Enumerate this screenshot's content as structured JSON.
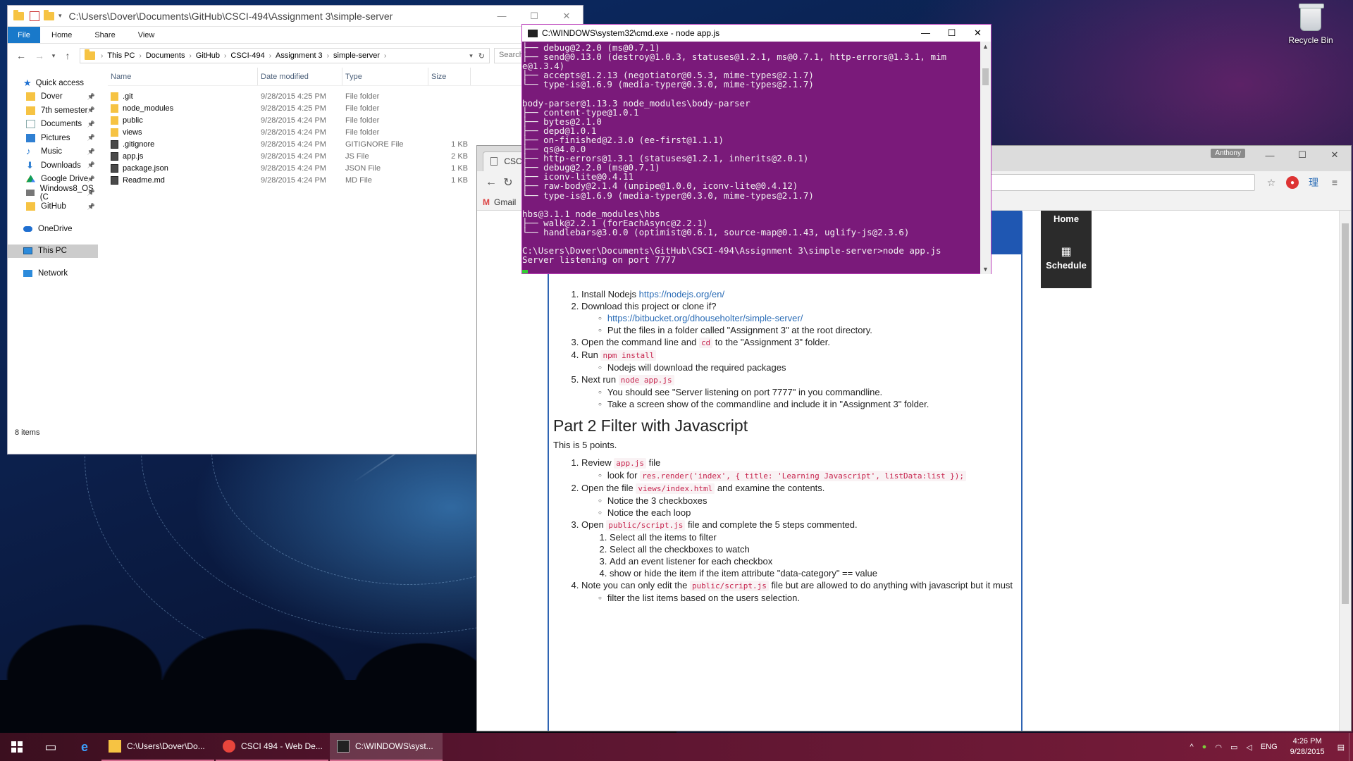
{
  "desktop": {
    "recycle_bin_label": "Recycle Bin"
  },
  "explorer": {
    "title": "C:\\Users\\Dover\\Documents\\GitHub\\CSCI-494\\Assignment 3\\simple-server",
    "ribbon_tabs": [
      "File",
      "Home",
      "Share",
      "View"
    ],
    "breadcrumbs": [
      "This PC",
      "Documents",
      "GitHub",
      "CSCI-494",
      "Assignment 3",
      "simple-server"
    ],
    "search_placeholder": "Search simple-s...",
    "nav": [
      {
        "label": "Quick access",
        "icon": "star-icon",
        "head": true
      },
      {
        "label": "Dover",
        "icon": "folder-icon",
        "pinned": false
      },
      {
        "label": "7th semester",
        "icon": "folder-icon",
        "pinned": true
      },
      {
        "label": "Documents",
        "icon": "documents-icon",
        "pinned": true
      },
      {
        "label": "Pictures",
        "icon": "pictures-icon",
        "pinned": true
      },
      {
        "label": "Music",
        "icon": "music-icon",
        "pinned": true
      },
      {
        "label": "Downloads",
        "icon": "download-icon",
        "pinned": true
      },
      {
        "label": "Google Drive",
        "icon": "google-drive-icon",
        "pinned": true
      },
      {
        "label": "Windows8_OS (C",
        "icon": "drive-icon",
        "pinned": true
      },
      {
        "label": "GitHub",
        "icon": "folder-icon",
        "pinned": true
      },
      {
        "label": "OneDrive",
        "icon": "onedrive-icon",
        "head": true
      },
      {
        "label": "This PC",
        "icon": "this-pc-icon",
        "head": true,
        "selected": true
      },
      {
        "label": "Network",
        "icon": "network-icon",
        "head": true
      }
    ],
    "columns": {
      "name": "Name",
      "date": "Date modified",
      "type": "Type",
      "size": "Size"
    },
    "files": [
      {
        "name": ".git",
        "date": "9/28/2015 4:25 PM",
        "type": "File folder",
        "size": "",
        "kind": "folder"
      },
      {
        "name": "node_modules",
        "date": "9/28/2015 4:25 PM",
        "type": "File folder",
        "size": "",
        "kind": "folder"
      },
      {
        "name": "public",
        "date": "9/28/2015 4:24 PM",
        "type": "File folder",
        "size": "",
        "kind": "folder"
      },
      {
        "name": "views",
        "date": "9/28/2015 4:24 PM",
        "type": "File folder",
        "size": "",
        "kind": "folder"
      },
      {
        "name": ".gitignore",
        "date": "9/28/2015 4:24 PM",
        "type": "GITIGNORE File",
        "size": "1 KB",
        "kind": "file"
      },
      {
        "name": "app.js",
        "date": "9/28/2015 4:24 PM",
        "type": "JS File",
        "size": "2 KB",
        "kind": "file"
      },
      {
        "name": "package.json",
        "date": "9/28/2015 4:24 PM",
        "type": "JSON File",
        "size": "1 KB",
        "kind": "file"
      },
      {
        "name": "Readme.md",
        "date": "9/28/2015 4:24 PM",
        "type": "MD File",
        "size": "1 KB",
        "kind": "file"
      }
    ],
    "status": "8 items"
  },
  "cmd": {
    "title": "C:\\WINDOWS\\system32\\cmd.exe - node  app.js",
    "lines": [
      "├── debug@2.2.0 (ms@0.7.1)",
      "├── send@0.13.0 (destroy@1.0.3, statuses@1.2.1, ms@0.7.1, http-errors@1.3.1, mim",
      "e@1.3.4)",
      "├── accepts@1.2.13 (negotiator@0.5.3, mime-types@2.1.7)",
      "└── type-is@1.6.9 (media-typer@0.3.0, mime-types@2.1.7)",
      "",
      "body-parser@1.13.3 node_modules\\body-parser",
      "├── content-type@1.0.1",
      "├── bytes@2.1.0",
      "├── depd@1.0.1",
      "├── on-finished@2.3.0 (ee-first@1.1.1)",
      "├── qs@4.0.0",
      "├── http-errors@1.3.1 (statuses@1.2.1, inherits@2.0.1)",
      "├── debug@2.2.0 (ms@0.7.1)",
      "├── iconv-lite@0.4.11",
      "├── raw-body@2.1.4 (unpipe@1.0.0, iconv-lite@0.4.12)",
      "└── type-is@1.6.9 (media-typer@0.3.0, mime-types@2.1.7)",
      "",
      "hbs@3.1.1 node_modules\\hbs",
      "├── walk@2.2.1 (forEachAsync@2.2.1)",
      "└── handlebars@3.0.0 (optimist@0.6.1, source-map@0.1.43, uglify-js@2.3.6)",
      "",
      "C:\\Users\\Dover\\Documents\\GitHub\\CSCI-494\\Assignment 3\\simple-server>node app.js",
      "Server listening on port 7777"
    ]
  },
  "chrome": {
    "tab_title": "CSCI 494",
    "user_badge": "Anthony",
    "bookmark": "Gmail",
    "side_nav": {
      "home": "Home",
      "schedule": "Schedule"
    },
    "doc": {
      "steps": [
        {
          "text": "Install Nodejs ",
          "link": "https://nodejs.org/en/"
        },
        {
          "text": "Download this project or clone if?"
        },
        {
          "text_a": "Open the command line and ",
          "code": "cd",
          "text_b": " to the \"Assignment 3\" folder."
        },
        {
          "text_a": "Run ",
          "code": "npm install"
        },
        {
          "text_a": "Next run ",
          "code": "node app.js"
        }
      ],
      "step2_sub": [
        "https://bitbucket.org/dhouseholter/simple-server/",
        "Put the files in a folder called \"Assignment 3\" at the root directory."
      ],
      "step4_sub": "Nodejs will download the required packages",
      "step5_sub": [
        "You should see \"Server listening on port 7777\" in you commandline.",
        "Take a screen show of the commandline and include it in \"Assignment 3\" folder."
      ],
      "part2_title": "Part 2 Filter with Javascript",
      "part2_points": "This is 5 points.",
      "p2_s1_a": "Review ",
      "p2_s1_code": "app.js",
      "p2_s1_b": " file",
      "p2_s1_sub_a": "look for ",
      "p2_s1_sub_code": "res.render('index', { title: 'Learning Javascript', listData:list });",
      "p2_s2_a": "Open the file ",
      "p2_s2_code": "views/index.html",
      "p2_s2_b": " and examine the contents.",
      "p2_s2_sub": [
        "Notice the 3 checkboxes",
        "Notice the each loop"
      ],
      "p2_s3_a": "Open ",
      "p2_s3_code": "public/script.js",
      "p2_s3_b": " file and complete the 5 steps commented.",
      "p2_s3_sub": [
        "Select all the items to filter",
        "Select all the checkboxes to watch",
        "Add an event listener for each checkbox",
        "show or hide the item if the item attribute \"data-category\" == value"
      ],
      "p2_s4_a": "Note you can only edit the ",
      "p2_s4_code": "public/script.js",
      "p2_s4_b": " file but are allowed to do anything with javascript but it must",
      "p2_s4_sub": "filter the list items based on the users selection."
    }
  },
  "taskbar": {
    "tasks": [
      {
        "label": "C:\\Users\\Dover\\Do...",
        "icon": "file-explorer-icon"
      },
      {
        "label": "CSCI 494 - Web De...",
        "icon": "chrome-icon"
      },
      {
        "label": "C:\\WINDOWS\\syst...",
        "icon": "cmd-icon",
        "active": true
      }
    ],
    "lang": "ENG",
    "time": "4:26 PM",
    "date": "9/28/2015"
  }
}
